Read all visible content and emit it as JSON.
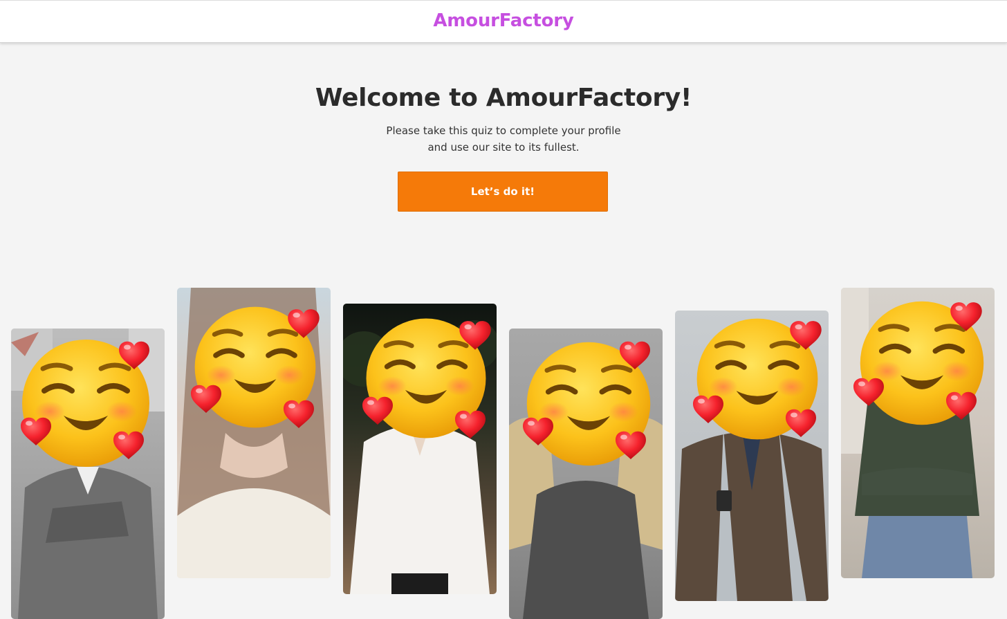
{
  "header": {
    "logo_text": "AmourFactory",
    "logo_color": "#c64fe0"
  },
  "hero": {
    "title": "Welcome to AmourFactory!",
    "subtitle_line1": "Please take this quiz to complete your profile",
    "subtitle_line2": "and use our site to its fullest.",
    "cta_label": "Let’s do it!",
    "cta_color": "#f57a09"
  },
  "profiles": [
    {
      "name": "profile-card-1",
      "overlay": "smiling-face-with-hearts-emoji",
      "photo": "man in grey suit, arms crossed"
    },
    {
      "name": "profile-card-2",
      "overlay": "smiling-face-with-hearts-emoji",
      "photo": "woman with long brown hair, white top"
    },
    {
      "name": "profile-card-3",
      "overlay": "smiling-face-with-hearts-emoji",
      "photo": "woman in white blouse, night street"
    },
    {
      "name": "profile-card-4",
      "overlay": "smiling-face-with-hearts-emoji",
      "photo": "woman with blonde wavy hair"
    },
    {
      "name": "profile-card-5",
      "overlay": "smiling-face-with-hearts-emoji",
      "photo": "man in suit with scarf and phone"
    },
    {
      "name": "profile-card-6",
      "overlay": "smiling-face-with-hearts-emoji",
      "photo": "woman in green ribbed sweater"
    }
  ]
}
